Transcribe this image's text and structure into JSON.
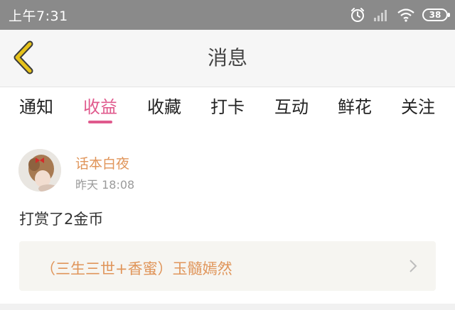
{
  "status_bar": {
    "time": "上午7:31",
    "battery": "38",
    "icons": [
      "alarm-icon",
      "signal-icon",
      "wifi-icon",
      "battery-icon"
    ]
  },
  "header": {
    "title": "消息",
    "back_icon": "chevron-left-icon"
  },
  "tabs": [
    {
      "label": "通知",
      "active": false
    },
    {
      "label": "收益",
      "active": true
    },
    {
      "label": "收藏",
      "active": false
    },
    {
      "label": "打卡",
      "active": false
    },
    {
      "label": "互动",
      "active": false
    },
    {
      "label": "鲜花",
      "active": false
    },
    {
      "label": "关注",
      "active": false
    }
  ],
  "message": {
    "sender": "话本白夜",
    "time": "昨天 18:08",
    "text": "打赏了2金币",
    "card_title": "（三生三世+香蜜）玉髓嫣然"
  },
  "colors": {
    "accent": "#e05a8d",
    "sender": "#e0955a",
    "back_arrow": "#e6c21a",
    "status_bar": "#8a8a8a"
  }
}
